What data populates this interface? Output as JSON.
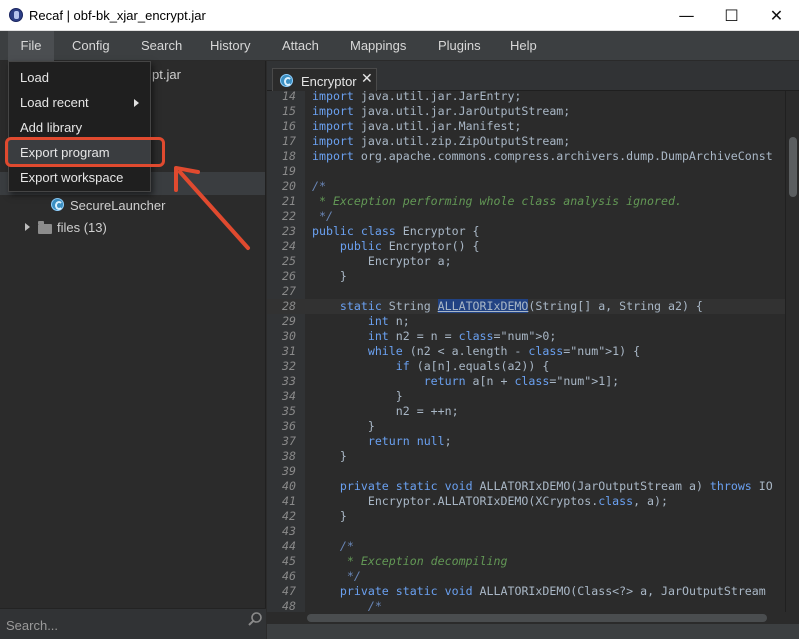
{
  "window": {
    "title": "Recaf | obf-bk_xjar_encrypt.jar",
    "minimize": "—",
    "maximize": "☐",
    "close": "✕"
  },
  "menubar": [
    "File",
    "Config",
    "Search",
    "History",
    "Attach",
    "Mappings",
    "Plugins",
    "Help"
  ],
  "file_menu": {
    "items": [
      "Load",
      "Load recent",
      "Add library",
      "Export program",
      "Export workspace"
    ],
    "highlighted": "Export program"
  },
  "tree": {
    "root_partial": "pt.jar",
    "class_item": "SecureLauncher",
    "files_folder": "files (13)"
  },
  "search": {
    "placeholder": "Search..."
  },
  "editor": {
    "tab_label": "Encryptor",
    "tab_close": "✕",
    "lines": [
      {
        "n": "14",
        "text": "import java.util.jar.JarEntry;"
      },
      {
        "n": "15",
        "text": "import java.util.jar.JarOutputStream;"
      },
      {
        "n": "16",
        "text": "import java.util.jar.Manifest;"
      },
      {
        "n": "17",
        "text": "import java.util.zip.ZipOutputStream;"
      },
      {
        "n": "18",
        "text": "import org.apache.commons.compress.archivers.dump.DumpArchiveConst"
      },
      {
        "n": "19",
        "text": ""
      },
      {
        "n": "20",
        "text": "/*"
      },
      {
        "n": "21",
        "text": " * Exception performing whole class analysis ignored."
      },
      {
        "n": "22",
        "text": " */"
      },
      {
        "n": "23",
        "text": "public class Encryptor {"
      },
      {
        "n": "24",
        "text": "    public Encryptor() {"
      },
      {
        "n": "25",
        "text": "        Encryptor a;"
      },
      {
        "n": "26",
        "text": "    }"
      },
      {
        "n": "27",
        "text": ""
      },
      {
        "n": "28",
        "text": "    static String ALLATORIxDEMO(String[] a, String a2) {"
      },
      {
        "n": "29",
        "text": "        int n;"
      },
      {
        "n": "30",
        "text": "        int n2 = n = 0;"
      },
      {
        "n": "31",
        "text": "        while (n2 < a.length - 1) {"
      },
      {
        "n": "32",
        "text": "            if (a[n].equals(a2)) {"
      },
      {
        "n": "33",
        "text": "                return a[n + 1];"
      },
      {
        "n": "34",
        "text": "            }"
      },
      {
        "n": "35",
        "text": "            n2 = ++n;"
      },
      {
        "n": "36",
        "text": "        }"
      },
      {
        "n": "37",
        "text": "        return null;"
      },
      {
        "n": "38",
        "text": "    }"
      },
      {
        "n": "39",
        "text": ""
      },
      {
        "n": "40",
        "text": "    private static void ALLATORIxDEMO(JarOutputStream a) throws IO"
      },
      {
        "n": "41",
        "text": "        Encryptor.ALLATORIxDEMO(XCryptos.class, a);"
      },
      {
        "n": "42",
        "text": "    }"
      },
      {
        "n": "43",
        "text": ""
      },
      {
        "n": "44",
        "text": "    /*"
      },
      {
        "n": "45",
        "text": "     * Exception decompiling"
      },
      {
        "n": "46",
        "text": "     */"
      },
      {
        "n": "47",
        "text": "    private static void ALLATORIxDEMO(Class<?> a, JarOutputStream"
      },
      {
        "n": "48",
        "text": "        /*"
      }
    ]
  },
  "colors": {
    "keyword": "#6aa0f0",
    "comment": "#629755",
    "annotation_box": "#e04a2f",
    "selection": "#214283"
  }
}
